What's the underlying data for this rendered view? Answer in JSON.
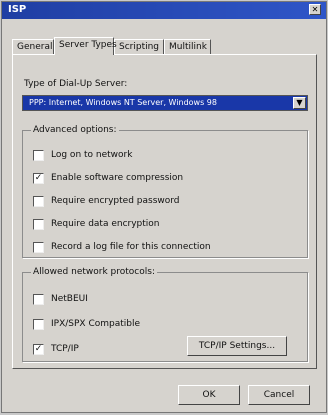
{
  "window": {
    "title": "ISP"
  },
  "tabs": [
    {
      "label": "General"
    },
    {
      "label": "Server Types"
    },
    {
      "label": "Scripting"
    },
    {
      "label": "Multilink"
    }
  ],
  "server_type": {
    "label": "Type of Dial-Up Server:",
    "value": "PPP: Internet, Windows NT Server, Windows 98"
  },
  "advanced": {
    "title": "Advanced options:",
    "items": [
      {
        "label": "Log on to network",
        "checked": false
      },
      {
        "label": "Enable software compression",
        "checked": true
      },
      {
        "label": "Require encrypted password",
        "checked": false
      },
      {
        "label": "Require data encryption",
        "checked": false
      },
      {
        "label": "Record a log file for this connection",
        "checked": false
      }
    ]
  },
  "protocols": {
    "title": "Allowed network protocols:",
    "items": [
      {
        "label": "NetBEUI",
        "checked": false
      },
      {
        "label": "IPX/SPX Compatible",
        "checked": false
      },
      {
        "label": "TCP/IP",
        "checked": true
      }
    ],
    "settings_button": "TCP/IP Settings..."
  },
  "footer": {
    "ok": "OK",
    "cancel": "Cancel"
  },
  "icons": {
    "close": "close-icon",
    "dropdown": "chevron-down-icon"
  }
}
